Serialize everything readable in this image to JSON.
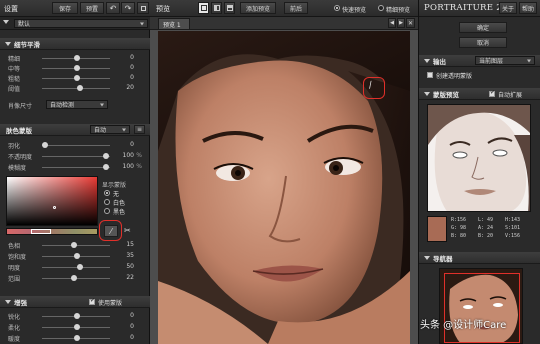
{
  "left": {
    "title": "设置",
    "reset_label": "保存",
    "presets_label": "预置",
    "preset_value": "默认",
    "detail_section": "细节平滑",
    "sliders": [
      {
        "label": "精细",
        "value": "0"
      },
      {
        "label": "中等",
        "value": "0"
      },
      {
        "label": "粗糙",
        "value": "0"
      },
      {
        "label": "阈值",
        "value": "20"
      }
    ],
    "size_label": "肖像尺寸",
    "size_value": "自动检测",
    "skin_section": "肤色蒙版",
    "skin_mode": "自动",
    "skin_sliders": [
      {
        "label": "羽化",
        "value": "0",
        "unit": ""
      },
      {
        "label": "不透明度",
        "value": "100",
        "unit": "%"
      },
      {
        "label": "模糊度",
        "value": "100",
        "unit": "%"
      }
    ],
    "show_mask_label": "显示蒙版",
    "mask_options": [
      {
        "label": "无",
        "on": true
      },
      {
        "label": "白色",
        "on": false
      },
      {
        "label": "黑色",
        "on": false
      }
    ],
    "color_sliders": [
      {
        "label": "色相",
        "value": "15"
      },
      {
        "label": "饱和度",
        "value": "35"
      },
      {
        "label": "明度",
        "value": "50"
      },
      {
        "label": "范围",
        "value": "22"
      }
    ],
    "enhance_section": "增强",
    "use_mask_label": "使用蒙版",
    "enhance_sliders": [
      {
        "label": "锐化",
        "value": "0"
      },
      {
        "label": "柔化",
        "value": "0"
      },
      {
        "label": "暖度",
        "value": "0"
      }
    ]
  },
  "center": {
    "title": "预览",
    "view_label": "添加预览",
    "before_label": "前后",
    "fast_preview": "快速预览",
    "fine_preview": "精细预览",
    "tab_label": "预览 1",
    "zoom_hint": "✕"
  },
  "right": {
    "logo": "PORTRAITURE 2",
    "about_label": "关于",
    "help_label": "帮助",
    "ok_label": "确定",
    "cancel_label": "取消",
    "output_section": "输出",
    "output_value": "当前图层",
    "new_layer_label": "创建透明蒙版",
    "mask_preview_section": "蒙版预览",
    "auto_expand_label": "自动扩展",
    "color_readout": {
      "r": "R:156",
      "g": "G: 98",
      "b": "B: 80",
      "l": "L:  49",
      "a": "A:  24",
      "bb": "B:  20",
      "h": "H:143",
      "s": "S:101",
      "v": "V:156"
    },
    "navigator_section": "导航器"
  },
  "watermark": "头条 @设计师Care",
  "colors": {
    "accent_red": "#e0302a",
    "swatch": "#a86b55",
    "panel": "#2a2a2a"
  }
}
